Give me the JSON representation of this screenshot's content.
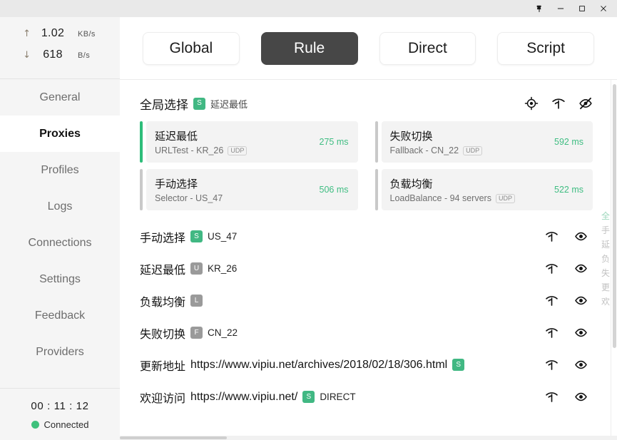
{
  "window": {
    "controls": [
      {
        "name": "pin",
        "label": "Pin"
      },
      {
        "name": "minimize",
        "label": "Minimize"
      },
      {
        "name": "maximize",
        "label": "Maximize"
      },
      {
        "name": "close",
        "label": "Close"
      }
    ]
  },
  "sidebar": {
    "speed": {
      "upload": {
        "arrow": "↑",
        "value": "1.02",
        "unit": "KB/s"
      },
      "download": {
        "arrow": "↓",
        "value": "618",
        "unit": "B/s"
      }
    },
    "nav": [
      {
        "label": "General",
        "active": false
      },
      {
        "label": "Proxies",
        "active": true
      },
      {
        "label": "Profiles",
        "active": false
      },
      {
        "label": "Logs",
        "active": false
      },
      {
        "label": "Connections",
        "active": false
      },
      {
        "label": "Settings",
        "active": false
      },
      {
        "label": "Feedback",
        "active": false
      },
      {
        "label": "Providers",
        "active": false
      }
    ],
    "status": {
      "timer": "00 : 11 : 12",
      "connection": "Connected",
      "dot_color": "#3ec17c"
    }
  },
  "modes": [
    {
      "label": "Global",
      "active": false
    },
    {
      "label": "Rule",
      "active": true
    },
    {
      "label": "Direct",
      "active": false
    },
    {
      "label": "Script",
      "active": false
    }
  ],
  "group_header": {
    "title": "全局选择",
    "badge": "S",
    "badge_color": "#41b883",
    "selected": "延迟最低",
    "icons": [
      "target-icon",
      "speedtest-icon",
      "eye-off-icon"
    ]
  },
  "cards": [
    {
      "name": "延迟最低",
      "meta": "URLTest - KR_26",
      "udp": "UDP",
      "delay": "275 ms",
      "active": true
    },
    {
      "name": "失败切换",
      "meta": "Fallback - CN_22",
      "udp": "UDP",
      "delay": "592 ms",
      "active": false
    },
    {
      "name": "手动选择",
      "meta": "Selector - US_47",
      "udp": "",
      "delay": "506 ms",
      "active": false
    },
    {
      "name": "负载均衡",
      "meta": "LoadBalance - 94 servers",
      "udp": "UDP",
      "delay": "522 ms",
      "active": false
    }
  ],
  "rows": [
    {
      "title": "手动选择",
      "badge": "S",
      "badge_kind": "green",
      "sub": "US_47",
      "url": ""
    },
    {
      "title": "延迟最低",
      "badge": "U",
      "badge_kind": "gray",
      "sub": "KR_26",
      "url": ""
    },
    {
      "title": "负载均衡",
      "badge": "L",
      "badge_kind": "gray",
      "sub": "",
      "url": ""
    },
    {
      "title": "失败切换",
      "badge": "F",
      "badge_kind": "gray",
      "sub": "CN_22",
      "url": ""
    },
    {
      "title": "更新地址",
      "badge": "S",
      "badge_kind": "green",
      "sub": "",
      "url": "https://www.vipiu.net/archives/2018/02/18/306.html",
      "url_before_badge": true
    },
    {
      "title": "欢迎访问",
      "badge": "S",
      "badge_kind": "green",
      "sub": "DIRECT",
      "url": "https://www.vipiu.net/",
      "url_before_badge": true
    }
  ],
  "row_icons": [
    "speedtest-icon",
    "eye-icon"
  ],
  "mini_index": [
    {
      "char": "全",
      "current": true
    },
    {
      "char": "手",
      "current": false
    },
    {
      "char": "延",
      "current": false
    },
    {
      "char": "负",
      "current": false
    },
    {
      "char": "失",
      "current": false
    },
    {
      "char": "更",
      "current": false
    },
    {
      "char": "欢",
      "current": false
    }
  ],
  "colors": {
    "accent_green": "#41b883",
    "delay_green": "#3fbd82",
    "active_mode_bg": "#474747",
    "sidebar_bg": "#f5f5f5"
  }
}
